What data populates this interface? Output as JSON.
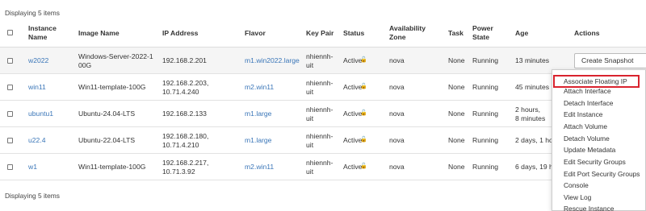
{
  "summary": {
    "top": "Displaying 5 items",
    "bottom": "Displaying 5 items"
  },
  "columns": {
    "instance_name": [
      "Instance",
      "Name"
    ],
    "image_name": "Image Name",
    "ip_address": "IP Address",
    "flavor": "Flavor",
    "key_pair": "Key Pair",
    "status": "Status",
    "availability_zone": [
      "Availability",
      "Zone"
    ],
    "task": "Task",
    "power_state": [
      "Power",
      "State"
    ],
    "age": "Age",
    "actions": "Actions"
  },
  "rows": [
    {
      "name": "w2022",
      "image": [
        "Windows-Server-2022-1",
        "00G"
      ],
      "ip": [
        "192.168.2.201"
      ],
      "flavor": "m1.win2022.large",
      "keypair": [
        "nhiennh-",
        "uit"
      ],
      "status": "Active",
      "zone": "nova",
      "task": "None",
      "power": "Running",
      "age": [
        "13 minutes"
      ]
    },
    {
      "name": "win11",
      "image": [
        "Win11-template-100G"
      ],
      "ip": [
        "192.168.2.203,",
        "10.71.4.240"
      ],
      "flavor": "m2.win11",
      "keypair": [
        "nhiennh-",
        "uit"
      ],
      "status": "Active",
      "zone": "nova",
      "task": "None",
      "power": "Running",
      "age": [
        "45 minutes"
      ]
    },
    {
      "name": "ubuntu1",
      "image": [
        "Ubuntu-24.04-LTS"
      ],
      "ip": [
        "192.168.2.133"
      ],
      "flavor": "m1.large",
      "keypair": [
        "nhiennh-",
        "uit"
      ],
      "status": "Active",
      "zone": "nova",
      "task": "None",
      "power": "Running",
      "age": [
        "2 hours,",
        "8 minutes"
      ]
    },
    {
      "name": "u22.4",
      "image": [
        "Ubuntu-22.04-LTS"
      ],
      "ip": [
        "192.168.2.180,",
        "10.71.4.210"
      ],
      "flavor": "m1.large",
      "keypair": [
        "nhiennh-",
        "uit"
      ],
      "status": "Active",
      "zone": "nova",
      "task": "None",
      "power": "Running",
      "age": [
        "2 days, 1 hou"
      ]
    },
    {
      "name": "w1",
      "image": [
        "Win11-template-100G"
      ],
      "ip": [
        "192.168.2.217,",
        "10.71.3.92"
      ],
      "flavor": "m2.win11",
      "keypair": [
        "nhiennh-",
        "uit"
      ],
      "status": "Active",
      "zone": "nova",
      "task": "None",
      "power": "Running",
      "age": [
        "6 days, 19 ho"
      ]
    }
  ],
  "actions": {
    "primary_label": "Create Snapshot",
    "menu": [
      "Associate Floating IP",
      "Attach Interface",
      "Detach Interface",
      "Edit Instance",
      "Attach Volume",
      "Detach Volume",
      "Update Metadata",
      "Edit Security Groups",
      "Edit Port Security Groups",
      "Console",
      "View Log",
      "Rescue Instance"
    ],
    "highlighted": "Associate Floating IP"
  },
  "colors": {
    "link": "#3a76b8",
    "highlight_border": "#d9232e",
    "selected_row_bg": "#f5f5f5"
  }
}
